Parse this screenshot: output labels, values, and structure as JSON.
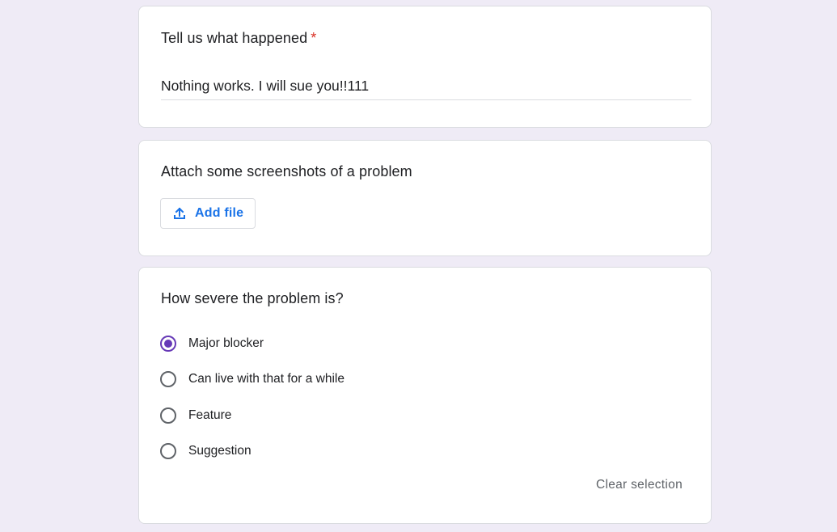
{
  "theme": {
    "background": "#efebf6",
    "accent": "#673ab7",
    "link_blue": "#1a73e8",
    "required_red": "#d93025"
  },
  "question_1": {
    "title": "Tell us what happened",
    "required_mark": "*",
    "answer": "Nothing works. I will sue you!!111"
  },
  "question_2": {
    "title": "Attach some screenshots of a problem",
    "add_file_label": "Add file",
    "add_file_icon": "upload-icon"
  },
  "question_3": {
    "title": "How severe the problem is?",
    "options": [
      {
        "label": "Major blocker",
        "selected": true
      },
      {
        "label": "Can live with that for a while",
        "selected": false
      },
      {
        "label": "Feature",
        "selected": false
      },
      {
        "label": "Suggestion",
        "selected": false
      }
    ],
    "clear_label": "Clear selection"
  }
}
